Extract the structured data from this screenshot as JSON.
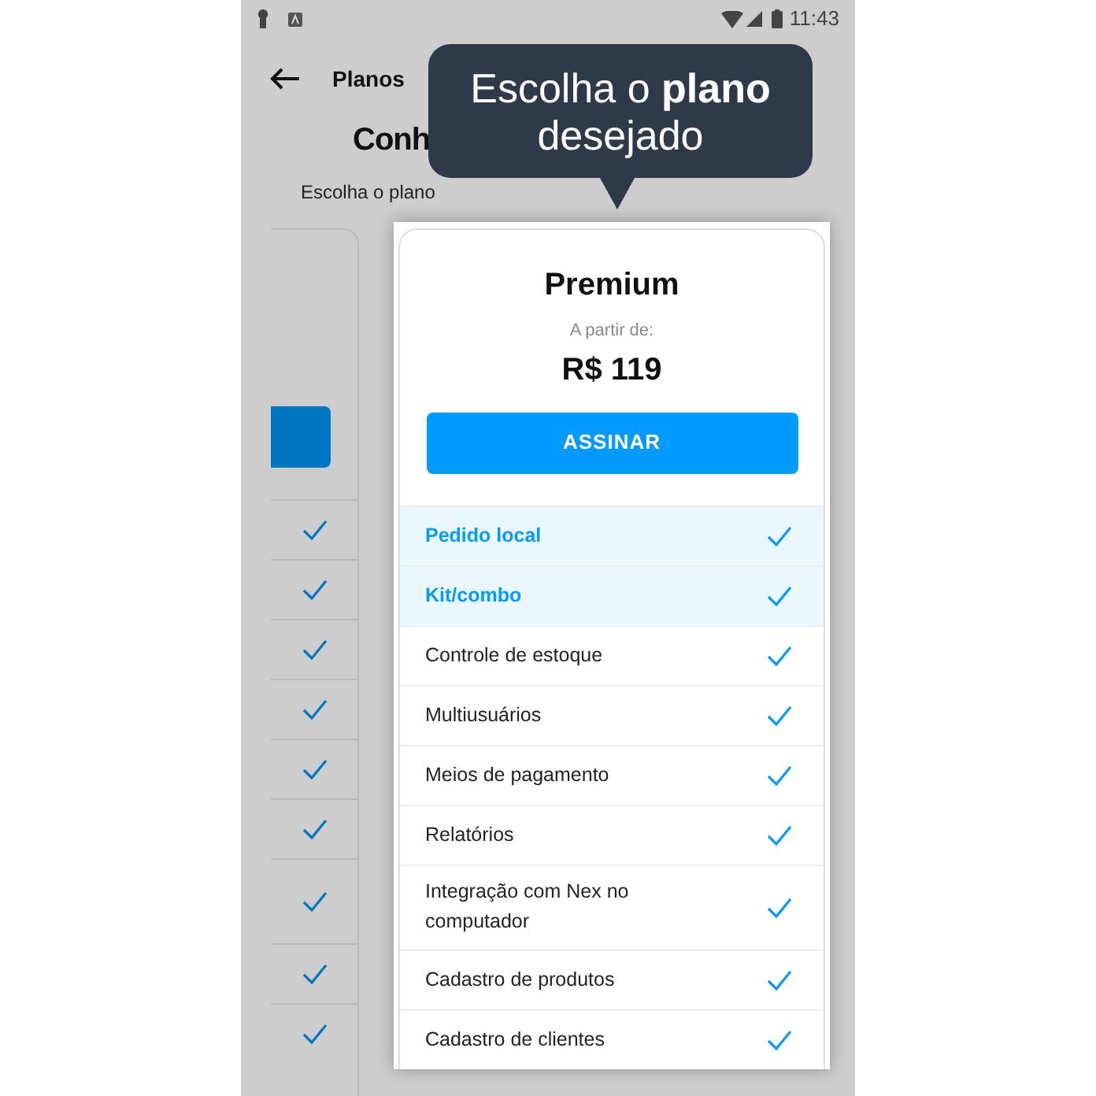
{
  "status_bar": {
    "time": "11:43"
  },
  "header": {
    "title": "Planos"
  },
  "page": {
    "title": "Conh",
    "subtitle": "Escolha o plano"
  },
  "tooltip": {
    "text": "Escolha o **plano** desejado"
  },
  "plan": {
    "name": "Premium",
    "price_label": "A partir de:",
    "price": "R$ 119",
    "button": "ASSINAR"
  },
  "features": [
    {
      "label": "Pedido local",
      "highlighted": true,
      "included": true,
      "previous_plan_included": true
    },
    {
      "label": "Kit/combo",
      "highlighted": true,
      "included": true,
      "previous_plan_included": true
    },
    {
      "label": "Controle de estoque",
      "highlighted": false,
      "included": true,
      "previous_plan_included": true
    },
    {
      "label": "Multiusuários",
      "highlighted": false,
      "included": true,
      "previous_plan_included": true
    },
    {
      "label": "Meios de pagamento",
      "highlighted": false,
      "included": true,
      "previous_plan_included": true
    },
    {
      "label": "Relatórios",
      "highlighted": false,
      "included": true,
      "previous_plan_included": true
    },
    {
      "label": "Integração com Nex no computador",
      "highlighted": false,
      "included": true,
      "previous_plan_included": true
    },
    {
      "label": "Cadastro de produtos",
      "highlighted": false,
      "included": true,
      "previous_plan_included": true
    },
    {
      "label": "Cadastro de clientes",
      "highlighted": false,
      "included": true,
      "previous_plan_included": true
    }
  ]
}
